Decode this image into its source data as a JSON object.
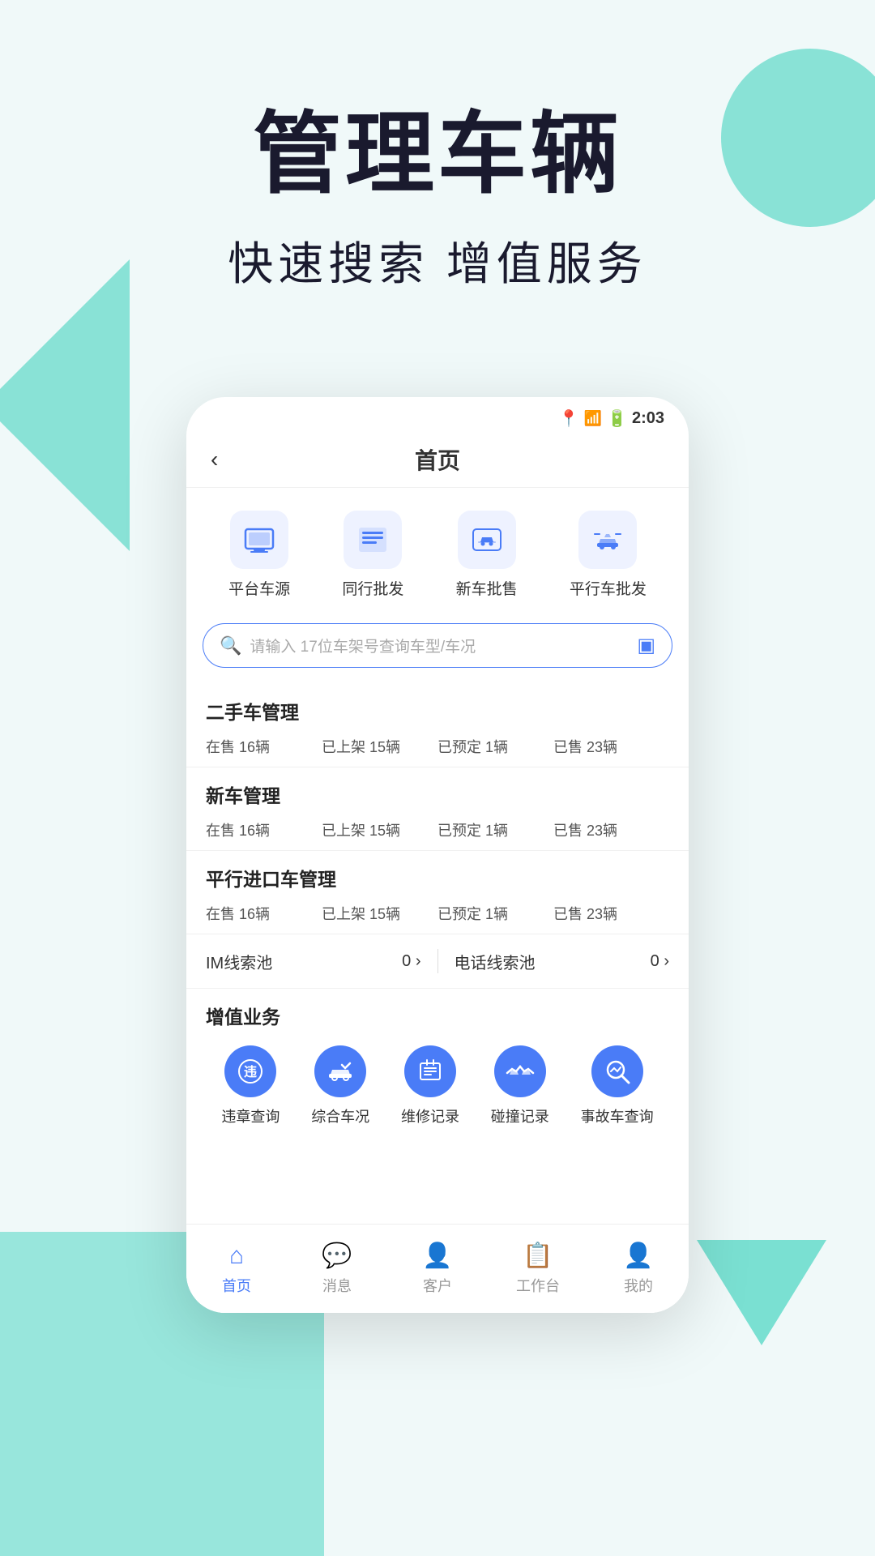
{
  "background": {
    "color": "#e8f7f5"
  },
  "header": {
    "main_title": "管理车辆",
    "sub_title": "快速搜索 增值服务"
  },
  "phone": {
    "status_bar": {
      "time": "2:03"
    },
    "nav": {
      "back_icon": "‹",
      "title": "首页"
    },
    "quick_actions": [
      {
        "label": "平台车源",
        "icon": "monitor"
      },
      {
        "label": "同行批发",
        "icon": "list"
      },
      {
        "label": "新车批售",
        "icon": "car-front"
      },
      {
        "label": "平行车批发",
        "icon": "car-service"
      }
    ],
    "search": {
      "placeholder": "请输入 17位车架号查询车型/车况"
    },
    "sections": [
      {
        "title": "二手车管理",
        "stats": [
          {
            "label": "在售 16辆"
          },
          {
            "label": "已上架 15辆"
          },
          {
            "label": "已预定 1辆"
          },
          {
            "label": "已售 23辆"
          }
        ]
      },
      {
        "title": "新车管理",
        "stats": [
          {
            "label": "在售 16辆"
          },
          {
            "label": "已上架 15辆"
          },
          {
            "label": "已预定 1辆"
          },
          {
            "label": "已售 23辆"
          }
        ]
      },
      {
        "title": "平行进口车管理",
        "stats": [
          {
            "label": "在售 16辆"
          },
          {
            "label": "已上架 15辆"
          },
          {
            "label": "已预定 1辆"
          },
          {
            "label": "已售 23辆"
          }
        ]
      }
    ],
    "pools": [
      {
        "label": "IM线索池",
        "count": "0"
      },
      {
        "label": "电话线索池",
        "count": "0"
      }
    ],
    "value_added": {
      "title": "增值业务",
      "items": [
        {
          "label": "违章查询",
          "icon": "violation"
        },
        {
          "label": "综合车况",
          "icon": "car-check"
        },
        {
          "label": "维修记录",
          "icon": "repair"
        },
        {
          "label": "碰撞记录",
          "icon": "crash"
        },
        {
          "label": "事故车查询",
          "icon": "accident"
        }
      ]
    },
    "bottom_nav": [
      {
        "label": "首页",
        "icon": "home",
        "active": true
      },
      {
        "label": "消息",
        "icon": "message",
        "active": false
      },
      {
        "label": "客户",
        "icon": "customer",
        "active": false
      },
      {
        "label": "工作台",
        "icon": "workbench",
        "active": false
      },
      {
        "label": "我的",
        "icon": "profile",
        "active": false
      }
    ]
  }
}
